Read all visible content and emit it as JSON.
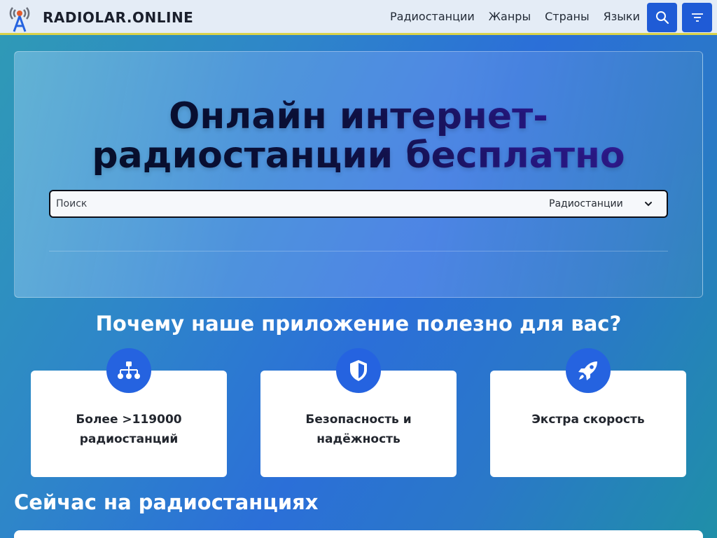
{
  "header": {
    "brand": "RADIOLAR.ONLINE",
    "nav": [
      "Радиостанции",
      "Жанры",
      "Страны",
      "Языки"
    ],
    "search_button_icon": "search-icon",
    "filter_button_icon": "filter-icon"
  },
  "hero": {
    "title_line1": "Онлайн интернет-",
    "title_line2": "радиостанции бесплатно",
    "search_placeholder": "Поиск",
    "search_type_selected": "Радиостанции"
  },
  "features": {
    "title": "Почему наше приложение полезно для вас?",
    "cards": [
      {
        "icon": "sitemap-icon",
        "line1": "Более >119000",
        "line2": "радиостанций"
      },
      {
        "icon": "shield-icon",
        "line1": "Безопасность и",
        "line2": "надёжность"
      },
      {
        "icon": "rocket-icon",
        "line1": "Экстра скорость",
        "line2": ""
      }
    ]
  },
  "now_on_air": {
    "title": "Сейчас на радиостанциях"
  },
  "colors": {
    "accent": "#2563e0",
    "header_bg": "#e4ecf6",
    "header_border": "#d9d24a",
    "title_dark": "#0d1240"
  }
}
